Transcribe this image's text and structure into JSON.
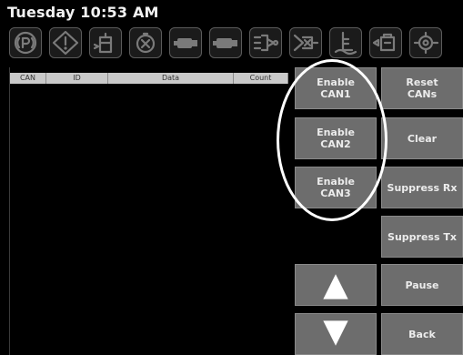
{
  "header": {
    "time": "Tuesday 10:53 AM"
  },
  "icon_bar": [
    {
      "name": "parking-brake-icon"
    },
    {
      "name": "warning-diamond-icon"
    },
    {
      "name": "fuel-filter-icon"
    },
    {
      "name": "oil-pressure-icon"
    },
    {
      "name": "engine-icon"
    },
    {
      "name": "engine-check-icon"
    },
    {
      "name": "fuel-system-icon"
    },
    {
      "name": "exhaust-filter-icon"
    },
    {
      "name": "fluid-level-icon"
    },
    {
      "name": "coolant-icon"
    },
    {
      "name": "transmission-icon"
    }
  ],
  "table": {
    "columns": [
      "CAN",
      "ID",
      "Data",
      "Count"
    ],
    "rows": []
  },
  "buttons": {
    "enable_can1": "Enable\nCAN1",
    "enable_can2": "Enable\nCAN2",
    "enable_can3": "Enable\nCAN3",
    "reset_cans": "Reset\nCANs",
    "clear": "Clear",
    "suppress_rx": "Suppress Rx",
    "suppress_tx": "Suppress Tx",
    "pause": "Pause",
    "back": "Back"
  },
  "icons": {
    "up": "up-arrow-icon",
    "down": "down-arrow-icon"
  },
  "colors": {
    "background": "#000000",
    "button": "#6d6d6d",
    "header_text": "#f2f2f2",
    "highlight_circle": "#ffffff"
  }
}
